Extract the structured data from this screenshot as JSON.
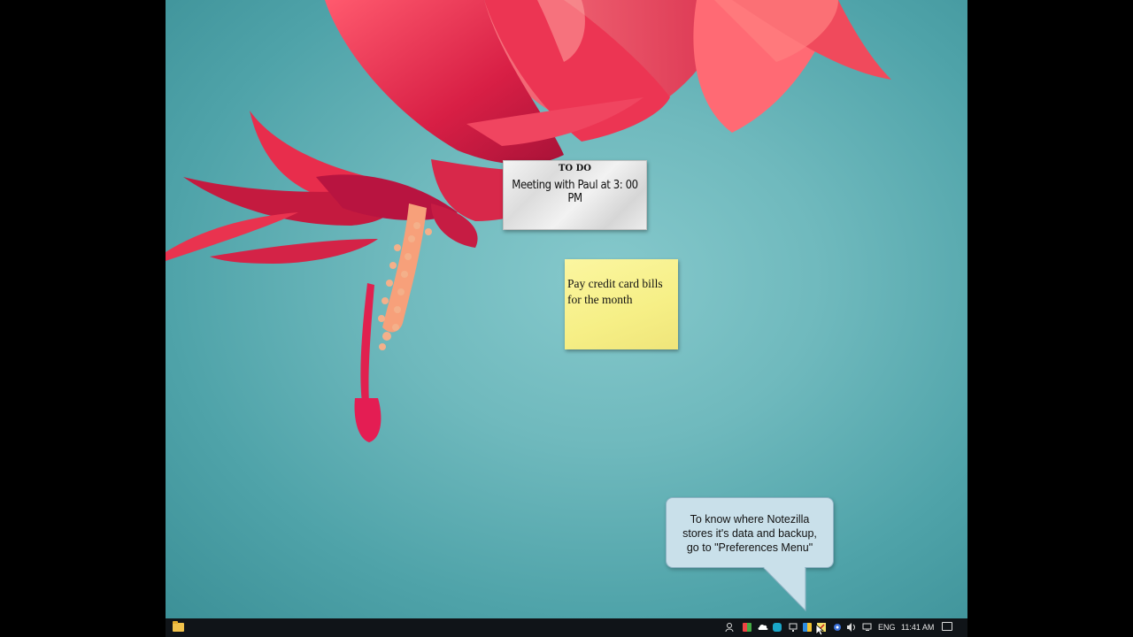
{
  "notes": {
    "todo": {
      "title": "TO DO",
      "body": "Meeting with Paul at 3: 00 PM"
    },
    "bills": {
      "line1": "Pay credit card bills",
      "line2": "for the month"
    }
  },
  "tooltip": {
    "line1": "To know where Notezilla",
    "line2": "stores it's data and backup,",
    "line3": "go to \"Preferences Menu\""
  },
  "taskbar": {
    "language": "ENG",
    "clock": "11:41 AM",
    "tray_icons": [
      "people-icon",
      "color-app-icon",
      "cloud-icon",
      "sync-icon",
      "monitor-icon",
      "windows-store-icon",
      "notezilla-icon",
      "network-app-icon",
      "volume-icon",
      "network-icon"
    ]
  },
  "colors": {
    "desktop": "#6fb9bd",
    "flower": "#e8334d",
    "taskbar": "#101418",
    "sticky_yellow": "#f6ef86",
    "tooltip_bg": "#c9e0ea"
  }
}
